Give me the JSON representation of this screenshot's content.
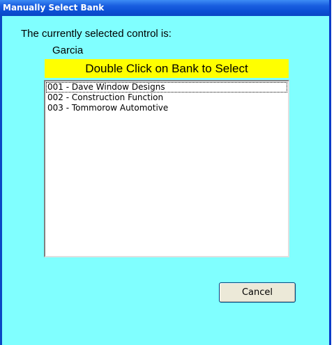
{
  "window": {
    "title": "Manually Select Bank"
  },
  "prompt": {
    "label": "The currently selected control is:",
    "control_name": "Garcia"
  },
  "instruction": "Double Click on Bank to Select",
  "banks": [
    "001 - Dave Window Designs",
    "002 - Construction Function",
    "003 - Tommorow Automotive"
  ],
  "focused_bank_index": 0,
  "buttons": {
    "cancel": "Cancel"
  },
  "colors": {
    "background": "#80ffff",
    "highlight": "#ffff00",
    "titlebar": "#0b4fd4"
  }
}
